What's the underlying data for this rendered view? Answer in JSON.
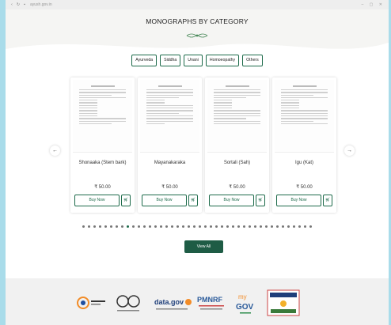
{
  "browser": {
    "url": "ayush.gov.in"
  },
  "section": {
    "title": "MONOGRAPHS BY CATEGORY"
  },
  "tabs": [
    {
      "label": "Ayurveda"
    },
    {
      "label": "Siddha"
    },
    {
      "label": "Unani"
    },
    {
      "label": "Homoeopathy"
    },
    {
      "label": "Others"
    }
  ],
  "cards": [
    {
      "title": "Shonaaka (Stem bark)",
      "price": "₹ 50.00",
      "buy_label": "Buy Now"
    },
    {
      "title": "Mayanakaraka",
      "price": "₹ 50.00",
      "buy_label": "Buy Now"
    },
    {
      "title": "Sortali (Sah)",
      "price": "₹ 50.00",
      "buy_label": "Buy Now"
    },
    {
      "title": "Igu (Kat)",
      "price": "₹ 50.00",
      "buy_label": "Buy Now"
    }
  ],
  "pagination": {
    "total": 42,
    "active_index": 8
  },
  "view_all_label": "View All",
  "footer_logos": [
    {
      "name": "Swachh Bharat"
    },
    {
      "name": "data.gov.in"
    },
    {
      "name": "PMNRF"
    },
    {
      "name": "myGov"
    },
    {
      "name": "India Code"
    }
  ],
  "colors": {
    "accent": "#1e6b4b",
    "button_bg": "#1e5c45",
    "background": "#a9dcea"
  }
}
